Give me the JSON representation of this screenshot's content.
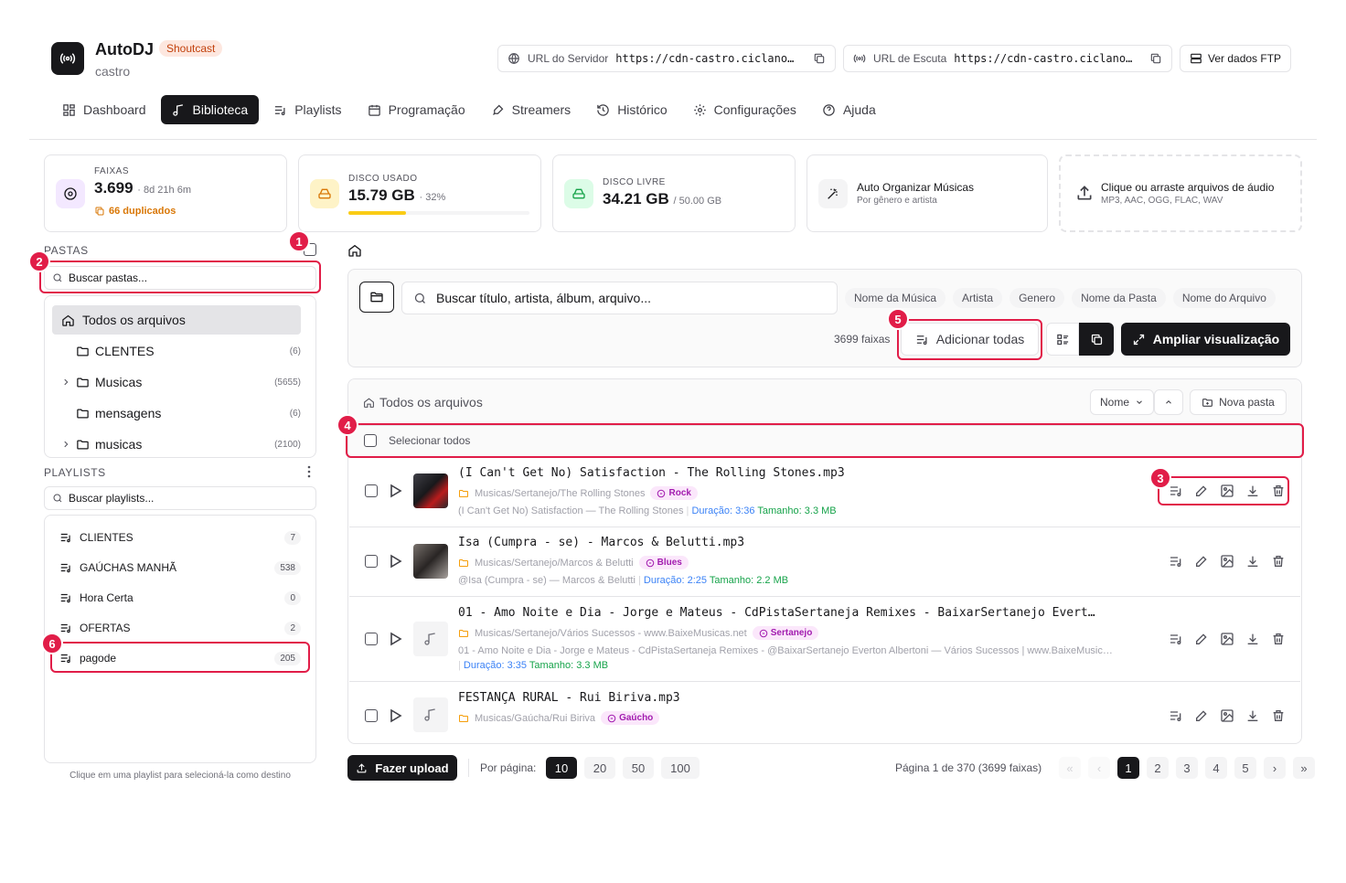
{
  "app": {
    "title": "AutoDJ",
    "badge": "Shoutcast",
    "subtitle": "castro"
  },
  "header": {
    "server_url_label": "URL do Servidor",
    "server_url_value": "https://cdn-castro.ciclano…",
    "listen_url_label": "URL de Escuta",
    "listen_url_value": "https://cdn-castro.ciclano…",
    "ftp_button": "Ver dados FTP"
  },
  "nav": [
    {
      "label": "Dashboard",
      "icon": "dashboard-icon"
    },
    {
      "label": "Biblioteca",
      "icon": "music-note-icon"
    },
    {
      "label": "Playlists",
      "icon": "playlist-icon"
    },
    {
      "label": "Programação",
      "icon": "calendar-icon"
    },
    {
      "label": "Streamers",
      "icon": "microphone-icon"
    },
    {
      "label": "Histórico",
      "icon": "history-icon"
    },
    {
      "label": "Configurações",
      "icon": "gear-icon"
    },
    {
      "label": "Ajuda",
      "icon": "help-icon"
    }
  ],
  "stats": {
    "tracks": {
      "label": "FAIXAS",
      "value": "3.699",
      "extra": "· 8d 21h 6m",
      "dup": "66 duplicados"
    },
    "disk_used": {
      "label": "DISCO USADO",
      "value": "15.79 GB",
      "extra": "· 32%",
      "percent": 32
    },
    "disk_free": {
      "label": "DISCO LIVRE",
      "value": "34.21 GB",
      "extra": "/ 50.00 GB"
    },
    "auto_org": {
      "title": "Auto Organizar Músicas",
      "sub": "Por gênero e artista"
    },
    "upload": {
      "title": "Clique ou arraste arquivos de áudio",
      "sub": "MP3, AAC, OGG, FLAC, WAV"
    }
  },
  "folders": {
    "title": "PASTAS",
    "search_placeholder": "Buscar pastas...",
    "all_files": "Todos os arquivos",
    "items": [
      {
        "name": "CLENTES",
        "count": "(6)"
      },
      {
        "name": "Musicas",
        "count": "(5655)"
      },
      {
        "name": "mensagens",
        "count": "(6)"
      },
      {
        "name": "musicas",
        "count": "(2100)"
      }
    ]
  },
  "playlists": {
    "title": "PLAYLISTS",
    "search_placeholder": "Buscar playlists...",
    "items": [
      {
        "name": "CLIENTES",
        "count": "7"
      },
      {
        "name": "GAÚCHAS MANHÃ",
        "count": "538"
      },
      {
        "name": "Hora Certa",
        "count": "0"
      },
      {
        "name": "OFERTAS",
        "count": "2"
      },
      {
        "name": "pagode",
        "count": "205"
      }
    ],
    "hint": "Clique em uma playlist para selecioná-la como destino"
  },
  "toolbar": {
    "search_placeholder": "Buscar título, artista, álbum, arquivo...",
    "filters": [
      "Nome da Música",
      "Artista",
      "Genero",
      "Nome da Pasta",
      "Nome do Arquivo"
    ],
    "count": "3699 faixas",
    "add_all": "Adicionar todas",
    "expand": "Ampliar visualização"
  },
  "list": {
    "breadcrumb": "Todos os arquivos",
    "sort": "Nome",
    "new_folder": "Nova pasta",
    "select_all": "Selecionar todos",
    "tracks": [
      {
        "title": "(I Can't Get No) Satisfaction - The Rolling Stones.mp3",
        "path": "Musicas/Sertanejo/The Rolling Stones",
        "genre": "Rock",
        "meta": "(I Can't Get No) Satisfaction — The Rolling Stones",
        "duration": "Duração: 3:36",
        "size": "Tamanho: 3.3 MB"
      },
      {
        "title": "Isa (Cumpra - se) - Marcos & Belutti.mp3",
        "path": "Musicas/Sertanejo/Marcos & Belutti",
        "genre": "Blues",
        "meta": "@Isa (Cumpra - se) — Marcos & Belutti",
        "duration": "Duração: 2:25",
        "size": "Tamanho: 2.2 MB"
      },
      {
        "title": "01 - Amo Noite e Dia - Jorge e Mateus - CdPistaSertaneja Remixes - BaixarSertanejo Evert…",
        "path": "Musicas/Sertanejo/Vários Sucessos - www.BaixeMusicas.net",
        "genre": "Sertanejo",
        "meta": "01 - Amo Noite e Dia - Jorge e Mateus - CdPistaSertaneja Remixes - @BaixarSertanejo Everton Albertoni — Vários Sucessos | www.BaixeMusic…",
        "duration": "Duração: 3:35",
        "size": "Tamanho: 3.3 MB"
      },
      {
        "title": "FESTANÇA RURAL - Rui Biriva.mp3",
        "path": "Musicas/Gaúcha/Rui Biriva",
        "genre": "Gaúcho",
        "meta": "",
        "duration": "",
        "size": ""
      }
    ]
  },
  "footer": {
    "upload": "Fazer upload",
    "per_page_label": "Por página:",
    "per_page": [
      "10",
      "20",
      "50",
      "100"
    ],
    "page_info": "Página 1 de 370 (3699 faixas)",
    "pages": [
      "1",
      "2",
      "3",
      "4",
      "5"
    ]
  },
  "markers": [
    "1",
    "2",
    "3",
    "4",
    "5",
    "6"
  ],
  "colors": {
    "accent": "#18181b",
    "highlight": "#e11d48",
    "progress": "#facc15",
    "genre": "#a21caf"
  }
}
